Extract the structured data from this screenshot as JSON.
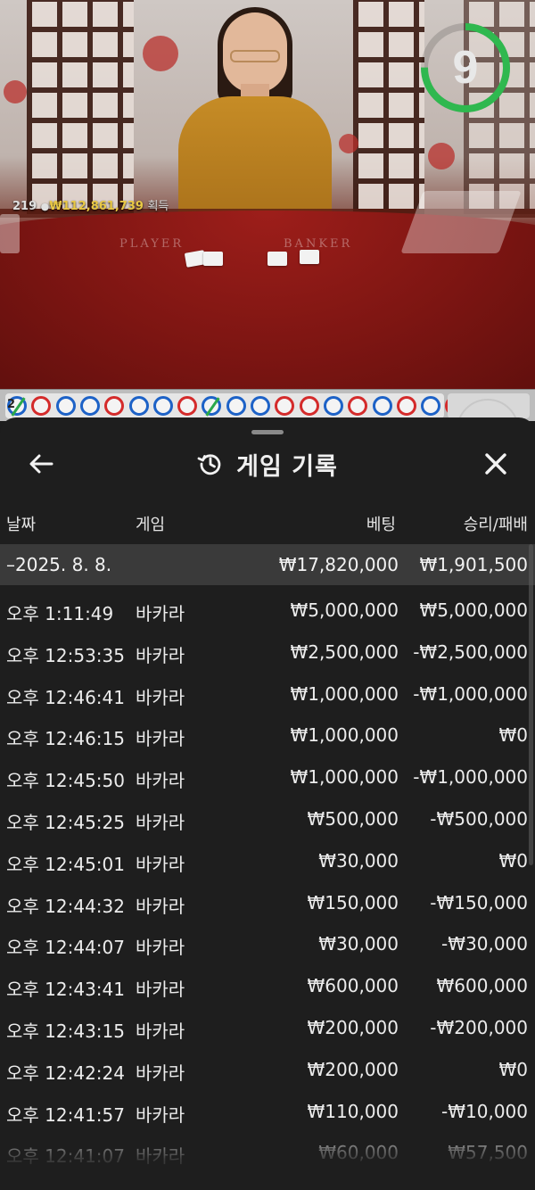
{
  "video": {
    "player_count": "219",
    "winnings": "₩112,861,739",
    "winnings_label": "획득",
    "timer_value": "9",
    "timer_progress": 0.75,
    "felt_player": "PLAYER",
    "felt_banker": "BANKER",
    "road_badge": "2"
  },
  "road": [
    "P",
    "B",
    "P",
    "P",
    "B",
    "P",
    "P",
    "B",
    "P",
    "P",
    "P",
    "B",
    "B",
    "P",
    "B",
    "P",
    "B",
    "P",
    "B"
  ],
  "sheet": {
    "title": "게임 기록",
    "title_icon": "history-icon",
    "back_icon": "arrow-left-icon",
    "close_icon": "close-icon",
    "columns": {
      "date": "날짜",
      "game": "게임",
      "bet": "베팅",
      "result": "승리/패배"
    },
    "group": {
      "date": "–2025. 8. 8.",
      "bet": "₩17,820,000",
      "result": "₩1,901,500"
    },
    "rows": [
      {
        "time": "오후 1:11:49",
        "game": "바카라",
        "bet": "₩5,000,000",
        "result": "₩5,000,000"
      },
      {
        "time": "오후 12:53:35",
        "game": "바카라",
        "bet": "₩2,500,000",
        "result": "-₩2,500,000"
      },
      {
        "time": "오후 12:46:41",
        "game": "바카라",
        "bet": "₩1,000,000",
        "result": "-₩1,000,000"
      },
      {
        "time": "오후 12:46:15",
        "game": "바카라",
        "bet": "₩1,000,000",
        "result": "₩0"
      },
      {
        "time": "오후 12:45:50",
        "game": "바카라",
        "bet": "₩1,000,000",
        "result": "-₩1,000,000"
      },
      {
        "time": "오후 12:45:25",
        "game": "바카라",
        "bet": "₩500,000",
        "result": "-₩500,000"
      },
      {
        "time": "오후 12:45:01",
        "game": "바카라",
        "bet": "₩30,000",
        "result": "₩0"
      },
      {
        "time": "오후 12:44:32",
        "game": "바카라",
        "bet": "₩150,000",
        "result": "-₩150,000"
      },
      {
        "time": "오후 12:44:07",
        "game": "바카라",
        "bet": "₩30,000",
        "result": "-₩30,000"
      },
      {
        "time": "오후 12:43:41",
        "game": "바카라",
        "bet": "₩600,000",
        "result": "₩600,000"
      },
      {
        "time": "오후 12:43:15",
        "game": "바카라",
        "bet": "₩200,000",
        "result": "-₩200,000"
      },
      {
        "time": "오후 12:42:24",
        "game": "바카라",
        "bet": "₩200,000",
        "result": "₩0"
      },
      {
        "time": "오후 12:41:57",
        "game": "바카라",
        "bet": "₩110,000",
        "result": "-₩10,000"
      },
      {
        "time": "오후 12:41:07",
        "game": "바카라",
        "bet": "₩60,000",
        "result": "₩57,500"
      }
    ]
  },
  "colors": {
    "player_blue": "#1d62c7",
    "banker_red": "#d42b2b",
    "timer_green": "#2fb84f",
    "winnings_gold": "#e9c845",
    "sheet_bg": "#1e1e1e",
    "group_bg": "#3a3a3a"
  }
}
